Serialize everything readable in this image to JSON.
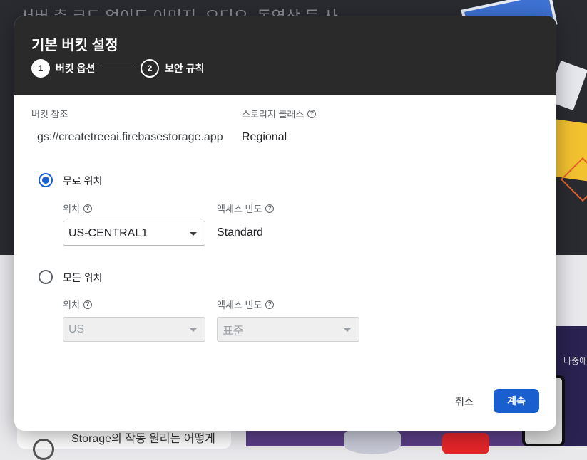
{
  "background": {
    "headline": "서버 측 코드 없이도 이미지, 오디오, 동영상 등 사",
    "card_text": "Storage의 작동 원리는 어떻게",
    "later_text": "나중에"
  },
  "dialog": {
    "title": "기본 버킷 설정",
    "steps": [
      {
        "number": "1",
        "label": "버킷 옵션",
        "active": true
      },
      {
        "number": "2",
        "label": "보안 규칙",
        "active": false
      }
    ],
    "bucket_ref_label": "버킷 참조",
    "bucket_ref_value": "gs://createtreeai.firebasestorage.app",
    "storage_class_label": "스토리지 클래스",
    "storage_class_value": "Regional",
    "free_location": {
      "radio_label": "무료 위치",
      "checked": true,
      "location_label": "위치",
      "location_value": "US-CENTRAL1",
      "access_label": "액세스 빈도",
      "access_value": "Standard"
    },
    "all_locations": {
      "radio_label": "모든 위치",
      "checked": false,
      "location_label": "위치",
      "location_value": "US",
      "access_label": "액세스 빈도",
      "access_value": "표준"
    },
    "cancel_label": "취소",
    "continue_label": "계속"
  },
  "colors": {
    "header_bg": "#2a2a2b",
    "primary": "#1a5fd0",
    "page_dark": "#292b31"
  },
  "icons": [
    "help-icon",
    "chevron-down-icon",
    "radio-checked-icon",
    "radio-unchecked-icon"
  ]
}
